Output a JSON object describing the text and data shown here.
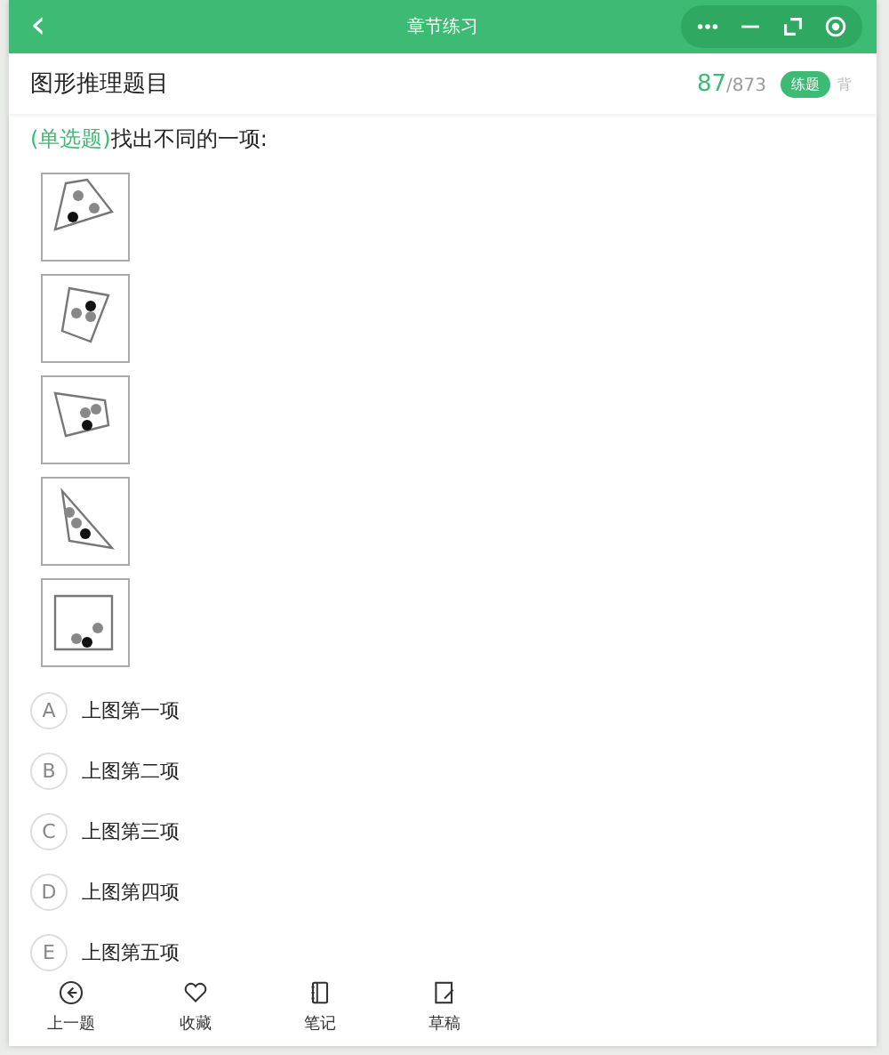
{
  "window": {
    "title": "章节练习",
    "back": "‹"
  },
  "header": {
    "title": "图形推理题目",
    "current": "87",
    "total": "/873",
    "mode_badge": "练题",
    "mode_alt": "背"
  },
  "question": {
    "type": "(单选题)",
    "text": "找出不同的一项:"
  },
  "options": [
    {
      "letter": "A",
      "text": "上图第一项",
      "selected": false
    },
    {
      "letter": "B",
      "text": "上图第二项",
      "selected": false
    },
    {
      "letter": "C",
      "text": "上图第三项",
      "selected": false
    },
    {
      "letter": "D",
      "text": "上图第四项",
      "selected": false
    },
    {
      "letter": "E",
      "text": "上图第五项",
      "selected": false
    }
  ],
  "toolbar": [
    {
      "kind": "previous",
      "label": "上一题"
    },
    {
      "kind": "favorite",
      "label": "收藏"
    },
    {
      "kind": "notes",
      "label": "笔记"
    },
    {
      "kind": "draft",
      "label": "草稿"
    }
  ]
}
